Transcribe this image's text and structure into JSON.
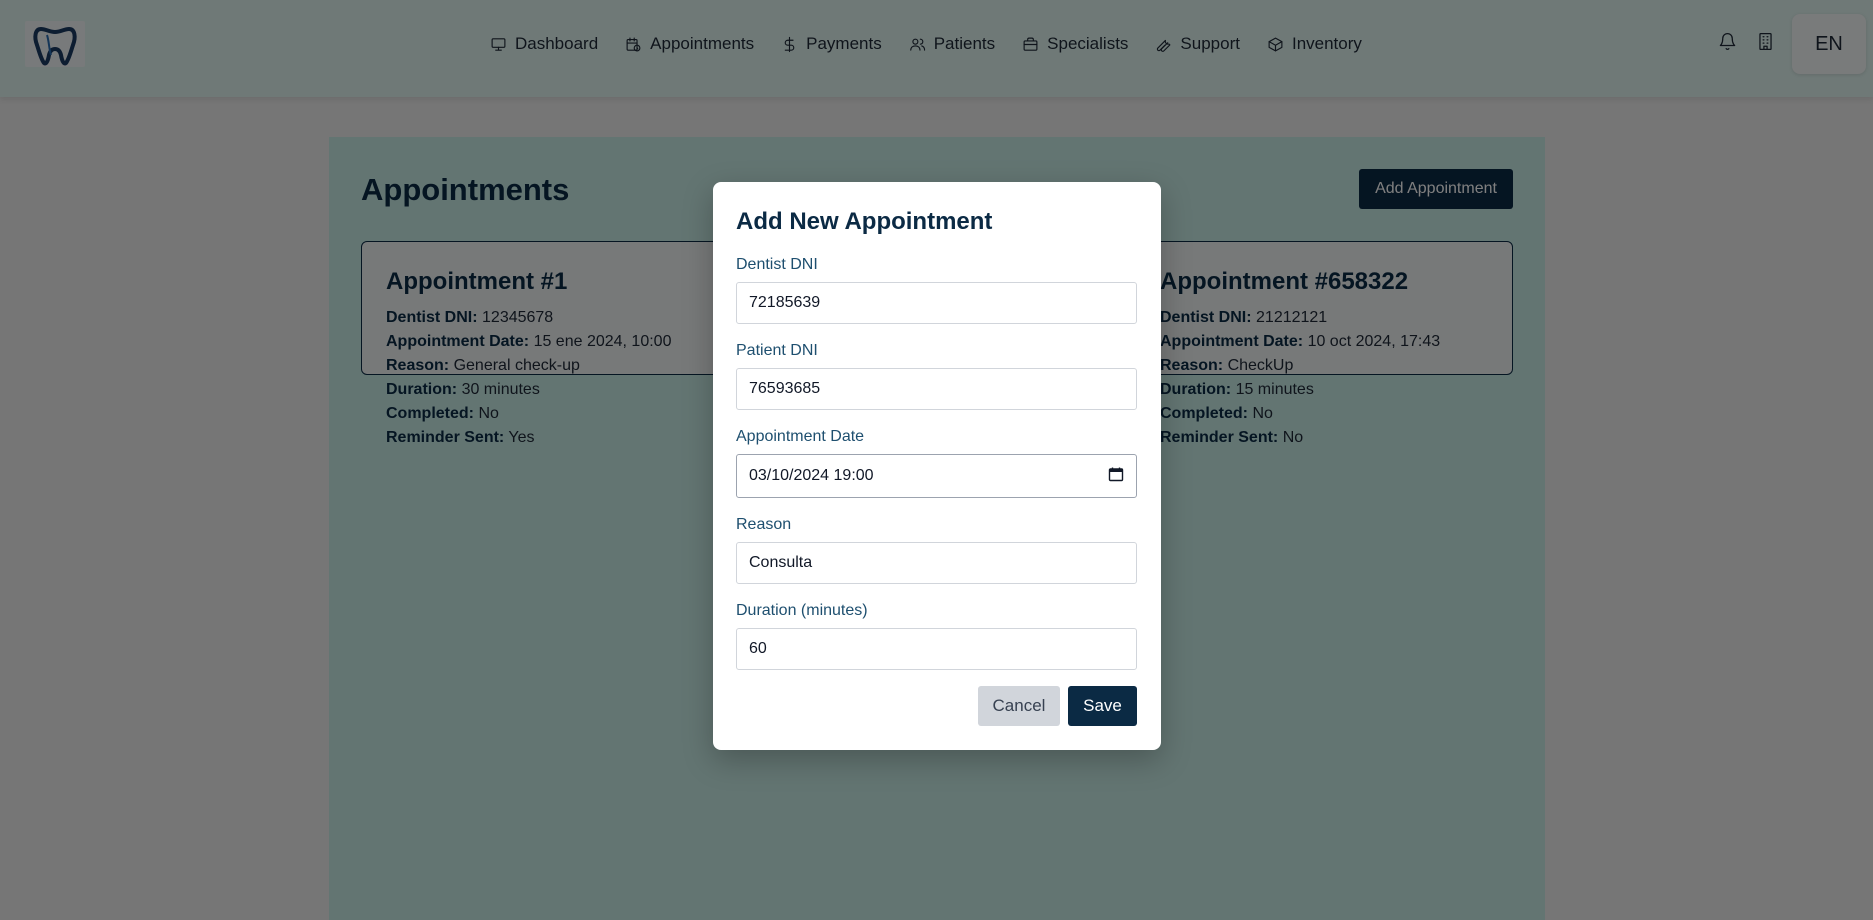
{
  "nav": {
    "items": [
      {
        "label": "Dashboard",
        "icon": "monitor-icon"
      },
      {
        "label": "Appointments",
        "icon": "calendar-clock-icon"
      },
      {
        "label": "Payments",
        "icon": "dollar-icon"
      },
      {
        "label": "Patients",
        "icon": "users-icon"
      },
      {
        "label": "Specialists",
        "icon": "briefcase-icon"
      },
      {
        "label": "Support",
        "icon": "wrench-icon"
      },
      {
        "label": "Inventory",
        "icon": "box-icon"
      }
    ],
    "language": "EN"
  },
  "page": {
    "title": "Appointments",
    "add_button": "Add Appointment"
  },
  "cards": [
    {
      "title": "Appointment #1",
      "dentist_dni_label": "Dentist DNI:",
      "dentist_dni": "12345678",
      "date_label": "Appointment Date:",
      "date": "15 ene 2024, 10:00",
      "reason_label": "Reason:",
      "reason": "General check-up",
      "duration_label": "Duration:",
      "duration": "30 minutes",
      "completed_label": "Completed:",
      "completed": "No",
      "reminder_label": "Reminder Sent:",
      "reminder": "Yes"
    },
    {
      "title": "Appointment #658322",
      "dentist_dni_label": "Dentist DNI:",
      "dentist_dni": "21212121",
      "date_label": "Appointment Date:",
      "date": "10 oct 2024, 17:43",
      "reason_label": "Reason:",
      "reason": "CheckUp",
      "duration_label": "Duration:",
      "duration": "15 minutes",
      "completed_label": "Completed:",
      "completed": "No",
      "reminder_label": "Reminder Sent:",
      "reminder": "No"
    }
  ],
  "modal": {
    "title": "Add New Appointment",
    "dentist_dni_label": "Dentist DNI",
    "dentist_dni_value": "72185639",
    "patient_dni_label": "Patient DNI",
    "patient_dni_value": "76593685",
    "date_label": "Appointment Date",
    "date_value": "03/10/2024 19:00",
    "reason_label": "Reason",
    "reason_value": "Consulta",
    "duration_label": "Duration (minutes)",
    "duration_value": "60",
    "cancel_label": "Cancel",
    "save_label": "Save"
  },
  "colors": {
    "navbar": "#dff3ef",
    "content_bg": "#c7eae5",
    "primary": "#0b2a44",
    "overlay": "rgba(0,0,0,0.5)"
  }
}
